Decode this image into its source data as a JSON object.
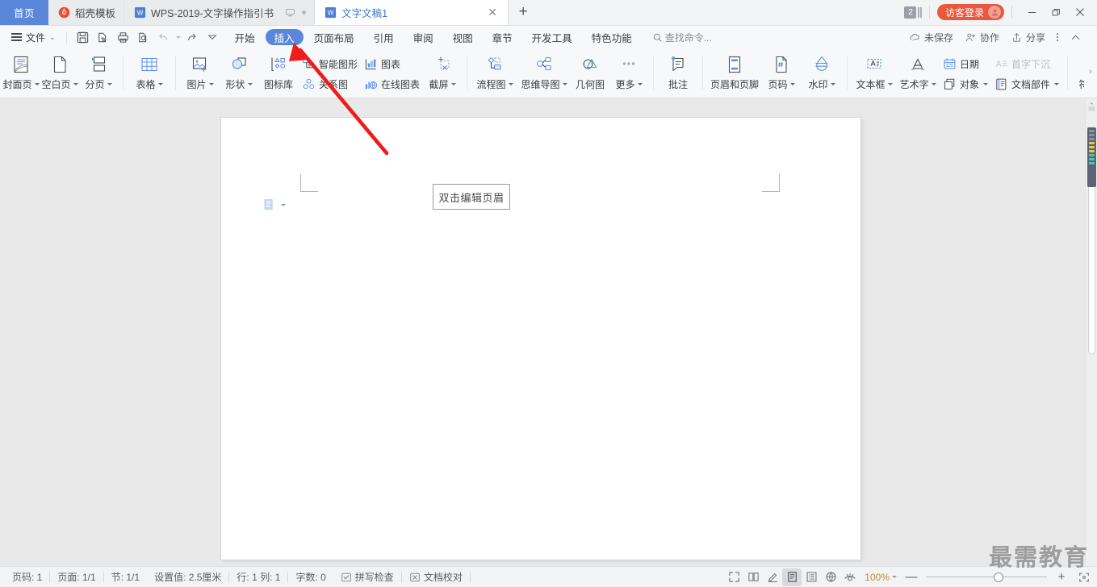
{
  "window": {
    "tabs": [
      {
        "name": "home-tab",
        "label": "首页",
        "type": "home"
      },
      {
        "name": "tab-daoke",
        "label": "稻壳模板",
        "type": "template",
        "active": false
      },
      {
        "name": "tab-wps2019",
        "label": "WPS-2019-文字操作指引书",
        "type": "doc",
        "active": false
      },
      {
        "name": "tab-wenzi1",
        "label": "文字文稿1",
        "type": "doc",
        "active": true
      }
    ],
    "new_tab_label": "+",
    "doc_count_badge": "2",
    "login_label": "访客登录",
    "minimize": "—",
    "restore": "❐",
    "close": "✕"
  },
  "menu": {
    "file_label": "文件",
    "quick_access": [
      {
        "name": "save-icon",
        "title": "保存"
      },
      {
        "name": "print-preview-icon",
        "title": "打印预览"
      },
      {
        "name": "print-icon",
        "title": "打印"
      },
      {
        "name": "find-icon",
        "title": "查找"
      },
      {
        "name": "undo-icon",
        "title": "撤销"
      },
      {
        "name": "redo-icon",
        "title": "重做"
      },
      {
        "name": "customize-icon",
        "title": "自定义快速访问工具栏"
      }
    ],
    "ribbon_tabs": [
      {
        "name": "tab-start",
        "label": "开始",
        "active": false
      },
      {
        "name": "tab-insert",
        "label": "插入",
        "active": true
      },
      {
        "name": "tab-page-layout",
        "label": "页面布局",
        "active": false
      },
      {
        "name": "tab-reference",
        "label": "引用",
        "active": false
      },
      {
        "name": "tab-review",
        "label": "审阅",
        "active": false
      },
      {
        "name": "tab-view",
        "label": "视图",
        "active": false
      },
      {
        "name": "tab-section",
        "label": "章节",
        "active": false
      },
      {
        "name": "tab-dev-tools",
        "label": "开发工具",
        "active": false
      },
      {
        "name": "tab-special",
        "label": "特色功能",
        "active": false
      }
    ],
    "find_command": "查找命令...",
    "right_items": [
      {
        "name": "unsaved-status",
        "label": "未保存"
      },
      {
        "name": "collaborate-button",
        "label": "协作"
      },
      {
        "name": "share-button",
        "label": "分享"
      }
    ],
    "collapse_ribbon": "︿"
  },
  "ribbon": {
    "groups": [
      {
        "name": "pages-group",
        "big": [
          {
            "name": "cover-page-button",
            "label": "封面页",
            "icon": "cover-page-icon",
            "caret": true
          },
          {
            "name": "blank-page-button",
            "label": "空白页",
            "icon": "blank-page-icon",
            "caret": true
          },
          {
            "name": "page-break-button",
            "label": "分页",
            "icon": "page-break-icon",
            "caret": true
          }
        ]
      },
      {
        "name": "table-group",
        "big": [
          {
            "name": "table-button",
            "label": "表格",
            "icon": "table-icon",
            "caret": true
          }
        ]
      },
      {
        "name": "illustration-group",
        "big": [
          {
            "name": "picture-button",
            "label": "图片",
            "icon": "picture-icon",
            "caret": true
          },
          {
            "name": "shape-button",
            "label": "形状",
            "icon": "shape-icon",
            "caret": true
          },
          {
            "name": "icon-library-button",
            "label": "图标库",
            "icon": "icon-library-icon",
            "caret": false
          }
        ],
        "small": [
          {
            "name": "smart-graphic-button",
            "label": "智能图形",
            "icon": "smart-graphic-icon"
          },
          {
            "name": "relation-graph-button",
            "label": "关系图",
            "icon": "relation-graph-icon"
          },
          {
            "name": "chart-button",
            "label": "图表",
            "icon": "chart-icon"
          },
          {
            "name": "online-chart-button",
            "label": "在线图表",
            "icon": "online-chart-icon"
          }
        ],
        "big_after": [
          {
            "name": "screenshot-button",
            "label": "截屏",
            "icon": "screenshot-icon",
            "caret": true
          }
        ]
      },
      {
        "name": "diagram-group",
        "big": [
          {
            "name": "flowchart-button",
            "label": "流程图",
            "icon": "flowchart-icon",
            "caret": true
          },
          {
            "name": "mindmap-button",
            "label": "思维导图",
            "icon": "mindmap-icon",
            "caret": true
          },
          {
            "name": "geometry-button",
            "label": "几何图",
            "icon": "geometry-icon",
            "caret": false
          },
          {
            "name": "more-button",
            "label": "更多",
            "icon": "more-dots-icon",
            "caret": true
          }
        ]
      },
      {
        "name": "comment-group",
        "big": [
          {
            "name": "comment-button",
            "label": "批注",
            "icon": "comment-icon",
            "caret": false
          }
        ]
      },
      {
        "name": "header-footer-group",
        "big": [
          {
            "name": "header-footer-button",
            "label": "页眉和页脚",
            "icon": "header-footer-icon",
            "caret": false
          },
          {
            "name": "page-number-button",
            "label": "页码",
            "icon": "page-number-icon",
            "caret": true
          },
          {
            "name": "watermark-button",
            "label": "水印",
            "icon": "watermark-icon",
            "caret": true
          }
        ]
      },
      {
        "name": "text-group",
        "big": [
          {
            "name": "textbox-button",
            "label": "文本框",
            "icon": "textbox-icon",
            "caret": true
          },
          {
            "name": "wordart-button",
            "label": "艺术字",
            "icon": "wordart-icon",
            "caret": true
          }
        ],
        "small": [
          {
            "name": "date-button",
            "label": "日期",
            "icon": "date-icon"
          },
          {
            "name": "object-button",
            "label": "对象",
            "icon": "object-icon",
            "caret": true
          },
          {
            "name": "drop-cap-button",
            "label": "首字下沉",
            "icon": "drop-cap-icon",
            "disabled": true
          },
          {
            "name": "doc-parts-button",
            "label": "文档部件",
            "icon": "doc-parts-icon",
            "caret": true
          }
        ]
      },
      {
        "name": "symbol-group",
        "big": [
          {
            "name": "symbol-button",
            "label": "符号",
            "icon": "symbol-icon",
            "caret": true
          }
        ]
      }
    ],
    "overflow_indicator": "›"
  },
  "document": {
    "header_hint": "双击编辑页眉",
    "watermark": "最需教育"
  },
  "status": {
    "left_items": [
      {
        "name": "status-page-number",
        "label": "页码: 1"
      },
      {
        "name": "status-page-count",
        "label": "页面: 1/1"
      },
      {
        "name": "status-section",
        "label": "节: 1/1"
      },
      {
        "name": "status-setting-value",
        "label": "设置值: 2.5厘米"
      },
      {
        "name": "status-row-col",
        "label": "行: 1   列: 1"
      },
      {
        "name": "status-word-count",
        "label": "字数: 0"
      },
      {
        "name": "status-spell-check",
        "label": "拼写检查",
        "icon": "spell-check-icon"
      },
      {
        "name": "status-doc-proofread",
        "label": "文档校对",
        "icon": "proofread-icon"
      }
    ],
    "view_buttons": [
      {
        "name": "fullscreen-view-button",
        "icon": "fullscreen-icon",
        "active": false
      },
      {
        "name": "book-view-button",
        "icon": "book-icon",
        "active": false
      },
      {
        "name": "edit-view-button",
        "icon": "pen-icon",
        "active": false
      },
      {
        "name": "page-view-button",
        "icon": "page-layout-icon",
        "active": true
      },
      {
        "name": "outline-view-button",
        "icon": "outline-icon",
        "active": false
      },
      {
        "name": "web-view-button",
        "icon": "globe-icon",
        "active": false
      },
      {
        "name": "eye-protect-button",
        "icon": "eye-icon",
        "active": false
      }
    ],
    "zoom_level": "100%",
    "zoom_out": "—",
    "zoom_in": "+",
    "fit_page": "fit-page-icon"
  },
  "colors": {
    "accent_blue": "#5b87da",
    "tab_home_blue": "#5b87da",
    "login_red": "#e9583e",
    "arrow_red": "#ef1c1c",
    "icon_blue": "#5b8ff0",
    "ribbon_bg": "#f7f8fa",
    "workspace_bg": "#e9e9e9",
    "zoom_text": "#c08a3e"
  }
}
